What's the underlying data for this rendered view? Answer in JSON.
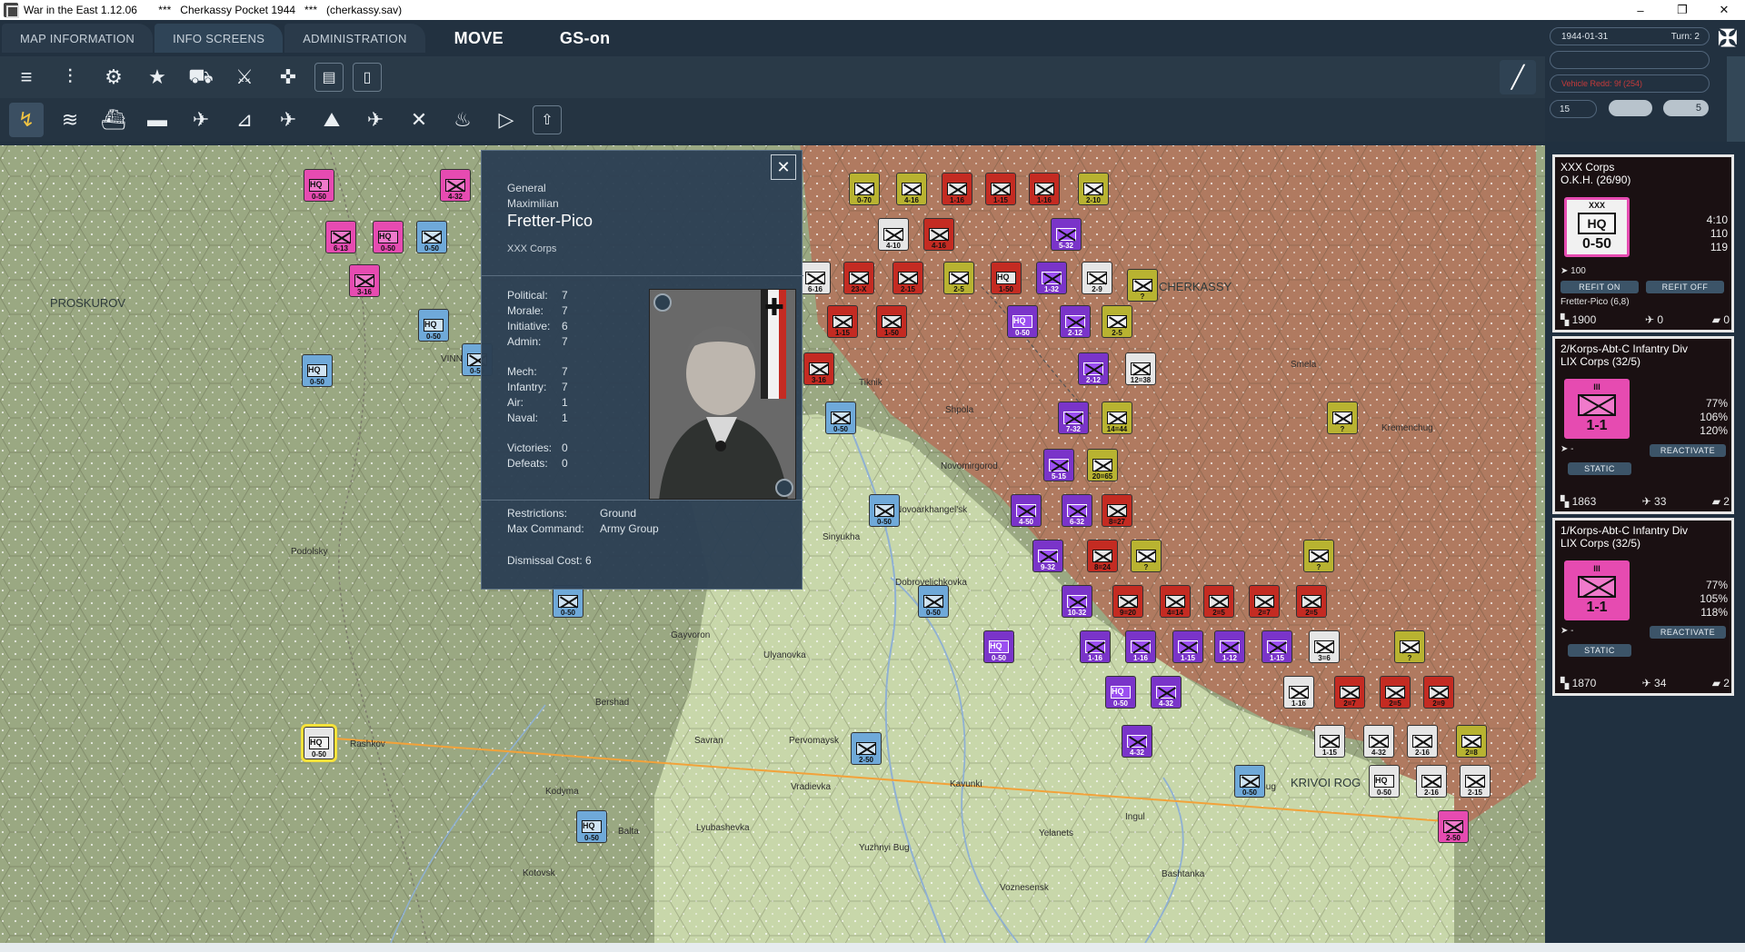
{
  "window": {
    "title": "War in the East 1.12.06       ***   Cherkassy Pocket 1944   ***   (cherkassy.sav)",
    "minimize": "–",
    "restore": "❐",
    "close": "✕"
  },
  "menu": {
    "tabs": [
      "MAP INFORMATION",
      "INFO SCREENS",
      "ADMINISTRATION"
    ],
    "mode_move": "MOVE",
    "mode_gs": "GS-on"
  },
  "toolbar1": [
    "≡",
    "⫶",
    "⚙",
    "★",
    "⛟",
    "⚔",
    "✜",
    "▤",
    "▯"
  ],
  "toolbar2": [
    {
      "icon": "↯",
      "key": "F1"
    },
    {
      "icon": "≋",
      "key": "F2"
    },
    {
      "icon": "⛴",
      "key": "F3"
    },
    {
      "icon": "▬",
      "key": "F4"
    },
    {
      "icon": "✈",
      "key": "F5"
    },
    {
      "icon": "⊿",
      "key": "F6"
    },
    {
      "icon": "✈",
      "key": "F7"
    },
    {
      "icon": "⛰",
      "key": "F8"
    },
    {
      "icon": "✈",
      "key": "F9"
    },
    {
      "icon": "✕",
      "key": "F10"
    },
    {
      "icon": "♨",
      "key": "F11"
    },
    {
      "icon": "▷",
      "key": "F12"
    },
    {
      "icon": "⇧",
      "key": ""
    }
  ],
  "tool_slash": "╱",
  "info": {
    "date": "1944-01-31",
    "turn": "Turn: 2",
    "blank_row": "",
    "vehicle_row": "Vehicle Redd: 9f (254)",
    "phase": "15",
    "weather_val": "5",
    "cross": "✠"
  },
  "leader": {
    "close": "✕",
    "rank": "General",
    "first_name": "Maximilian",
    "last_name": "Fretter-Pico",
    "command": "XXX Corps",
    "stats": [
      {
        "k": "Political:",
        "v": "7"
      },
      {
        "k": "Morale:",
        "v": "7"
      },
      {
        "k": "Initiative:",
        "v": "6"
      },
      {
        "k": "Admin:",
        "v": "7"
      },
      {
        "k": "Mech:",
        "v": "7"
      },
      {
        "k": "Infantry:",
        "v": "7"
      },
      {
        "k": "Air:",
        "v": "1"
      },
      {
        "k": "Naval:",
        "v": "1"
      },
      {
        "k": "Victories:",
        "v": "0"
      },
      {
        "k": "Defeats:",
        "v": "0"
      }
    ],
    "restrictions_label": "Restrictions:",
    "restrictions_value": "Ground",
    "max_command_label": "Max Command:",
    "max_command_value": "Army Group",
    "dismissal": "Dismissal Cost:  6"
  },
  "cards": [
    {
      "name1": "XXX Corps",
      "name2": "O.K.H. (26/90)",
      "size": "XXX",
      "box": "HQ",
      "cv": "0-50",
      "stats": [
        "4:10",
        "110",
        "119"
      ],
      "support": "100",
      "btn1": "REFIT ON",
      "btn2": "REFIT OFF",
      "leader": "Fretter-Pico (6,8)",
      "men": "1900",
      "guns": "0",
      "afv": "0"
    },
    {
      "name1": "2/Korps-Abt-C Infantry Div",
      "name2": "LIX Corps (32/5)",
      "size": "III",
      "box": "",
      "cv": "1-1",
      "stats": [
        "77%",
        "106%",
        "120%"
      ],
      "support": "-",
      "btn1": "REACTIVATE",
      "btn2": "STATIC",
      "men": "1863",
      "guns": "33",
      "afv": "2"
    },
    {
      "name1": "1/Korps-Abt-C Infantry Div",
      "name2": "LIX Corps (32/5)",
      "size": "III",
      "box": "",
      "cv": "1-1",
      "stats": [
        "77%",
        "105%",
        "118%"
      ],
      "support": "-",
      "btn1": "REACTIVATE",
      "btn2": "STATIC",
      "men": "1870",
      "guns": "34",
      "afv": "2"
    }
  ],
  "map_labels": [
    "CHERKASSY",
    "KRIVOI ROG",
    "PROSKUROV",
    "VINNITSA",
    "Smela",
    "Shpola",
    "Novomirgorod",
    "Novoarkhangel'sk",
    "Ulyanovka",
    "Pervomaysk",
    "Savran",
    "Vradievka",
    "Kavunki",
    "Voznesensk",
    "Bashtanka",
    "Lyubashevka",
    "Balta",
    "Kotovsk",
    "Yelanets",
    "Dobrovelichkovka",
    "Kremenchug",
    "Tiknik",
    "Sinyukha",
    "Yuzhnyi Bug",
    "Ingul",
    "Gayvoron",
    "Bershad",
    "Podolsky",
    "Nova Bug",
    "Kodyma",
    "Rashkov"
  ],
  "units": [
    {
      "c": "magenta",
      "t": "0-50",
      "hq": "HQ"
    },
    {
      "c": "magenta",
      "t": "4-32",
      "hq": ""
    },
    {
      "c": "magenta",
      "t": "6-13",
      "hq": ""
    },
    {
      "c": "magenta",
      "t": "0-50",
      "hq": "HQ"
    },
    {
      "c": "blue",
      "t": "0-50",
      "hq": ""
    },
    {
      "c": "magenta",
      "t": "3-16",
      "hq": ""
    },
    {
      "c": "blue",
      "t": "0-50",
      "hq": "HQ"
    },
    {
      "c": "blue",
      "t": "0-50",
      "hq": "HQ"
    },
    {
      "c": "olive",
      "t": "0-70",
      "hq": ""
    },
    {
      "c": "olive",
      "t": "4-16",
      "hq": ""
    },
    {
      "c": "red",
      "t": "1-16",
      "hq": ""
    },
    {
      "c": "red",
      "t": "1-15",
      "hq": ""
    },
    {
      "c": "red",
      "t": "1-16",
      "hq": ""
    },
    {
      "c": "olive",
      "t": "2-10",
      "hq": ""
    },
    {
      "c": "white",
      "t": "4-10",
      "hq": ""
    },
    {
      "c": "red",
      "t": "4-16",
      "hq": ""
    },
    {
      "c": "purple",
      "t": "5-32",
      "hq": ""
    },
    {
      "c": "white",
      "t": "6-16",
      "hq": ""
    },
    {
      "c": "red",
      "t": "23-X",
      "hq": ""
    },
    {
      "c": "red",
      "t": "2-15",
      "hq": ""
    },
    {
      "c": "olive",
      "t": "2-5",
      "hq": ""
    },
    {
      "c": "red",
      "t": "1-50",
      "hq": "HQ"
    },
    {
      "c": "purple",
      "t": "1-32",
      "hq": ""
    },
    {
      "c": "white",
      "t": "2-9",
      "hq": ""
    },
    {
      "c": "olive",
      "t": "?",
      "hq": ""
    },
    {
      "c": "red",
      "t": "1-15",
      "hq": ""
    },
    {
      "c": "red",
      "t": "1-50",
      "hq": ""
    },
    {
      "c": "purple",
      "t": "0-50",
      "hq": "HQ"
    },
    {
      "c": "purple",
      "t": "2-12",
      "hq": ""
    },
    {
      "c": "olive",
      "t": "2-5",
      "hq": ""
    },
    {
      "c": "red",
      "t": "3-16",
      "hq": ""
    },
    {
      "c": "purple",
      "t": "2-12",
      "hq": ""
    },
    {
      "c": "white",
      "t": "12=38",
      "hq": ""
    },
    {
      "c": "blue",
      "t": "0-50",
      "hq": ""
    },
    {
      "c": "purple",
      "t": "7-32",
      "hq": ""
    },
    {
      "c": "olive",
      "t": "14=44",
      "hq": ""
    },
    {
      "c": "olive",
      "t": "?",
      "hq": ""
    },
    {
      "c": "purple",
      "t": "5-15",
      "hq": ""
    },
    {
      "c": "olive",
      "t": "20=65",
      "hq": ""
    },
    {
      "c": "blue",
      "t": "0-50",
      "hq": ""
    },
    {
      "c": "purple",
      "t": "4-50",
      "hq": ""
    },
    {
      "c": "purple",
      "t": "6-32",
      "hq": ""
    },
    {
      "c": "red",
      "t": "8=27",
      "hq": ""
    },
    {
      "c": "purple",
      "t": "9-32",
      "hq": ""
    },
    {
      "c": "red",
      "t": "8=24",
      "hq": ""
    },
    {
      "c": "olive",
      "t": "?",
      "hq": ""
    },
    {
      "c": "olive",
      "t": "?",
      "hq": ""
    },
    {
      "c": "blue",
      "t": "0-50",
      "hq": ""
    },
    {
      "c": "blue",
      "t": "0-50",
      "hq": ""
    },
    {
      "c": "purple",
      "t": "10-32",
      "hq": ""
    },
    {
      "c": "red",
      "t": "9=20",
      "hq": ""
    },
    {
      "c": "red",
      "t": "4=14",
      "hq": ""
    },
    {
      "c": "red",
      "t": "2=5",
      "hq": ""
    },
    {
      "c": "red",
      "t": "2=7",
      "hq": ""
    },
    {
      "c": "red",
      "t": "2=5",
      "hq": ""
    },
    {
      "c": "purple",
      "t": "0-50",
      "hq": "HQ"
    },
    {
      "c": "purple",
      "t": "1-16",
      "hq": ""
    },
    {
      "c": "purple",
      "t": "1-16",
      "hq": ""
    },
    {
      "c": "purple",
      "t": "1-15",
      "hq": ""
    },
    {
      "c": "purple",
      "t": "1-12",
      "hq": ""
    },
    {
      "c": "purple",
      "t": "1-15",
      "hq": ""
    },
    {
      "c": "white",
      "t": "3=6",
      "hq": ""
    },
    {
      "c": "olive",
      "t": "?",
      "hq": ""
    },
    {
      "c": "purple",
      "t": "0-50",
      "hq": "HQ"
    },
    {
      "c": "purple",
      "t": "4-32",
      "hq": ""
    },
    {
      "c": "white",
      "t": "1-16",
      "hq": ""
    },
    {
      "c": "red",
      "t": "2=7",
      "hq": ""
    },
    {
      "c": "red",
      "t": "2=5",
      "hq": ""
    },
    {
      "c": "red",
      "t": "2=9",
      "hq": ""
    },
    {
      "c": "purple",
      "t": "4-32",
      "hq": ""
    },
    {
      "c": "white",
      "t": "1-15",
      "hq": ""
    },
    {
      "c": "white",
      "t": "4-32",
      "hq": ""
    },
    {
      "c": "white",
      "t": "2-16",
      "hq": ""
    },
    {
      "c": "olive",
      "t": "2=8",
      "hq": ""
    },
    {
      "c": "blue",
      "t": "2-50",
      "hq": ""
    },
    {
      "c": "white",
      "t": "0-50",
      "hq": "HQ"
    },
    {
      "c": "white",
      "t": "2-16",
      "hq": ""
    },
    {
      "c": "white",
      "t": "2-15",
      "hq": ""
    },
    {
      "c": "blue",
      "t": "0-50",
      "hq": ""
    },
    {
      "c": "white",
      "t": "0-50",
      "hq": "HQ"
    },
    {
      "c": "blue",
      "t": "0-50",
      "hq": "HQ"
    },
    {
      "c": "magenta",
      "t": "2-50",
      "hq": ""
    },
    {
      "c": "blue",
      "t": "0-50",
      "hq": ""
    }
  ],
  "colors": {
    "bg": "#1e2a35",
    "toolbar": "#2a3a48",
    "popup": "#2c4054",
    "accent_magenta": "#e64bb1",
    "soviet_red": "#c42b22",
    "axis_purple": "#7a34c9",
    "map_green": "#a8b98a",
    "map_brown": "#b27a62",
    "map_light": "#cfdcb1"
  }
}
